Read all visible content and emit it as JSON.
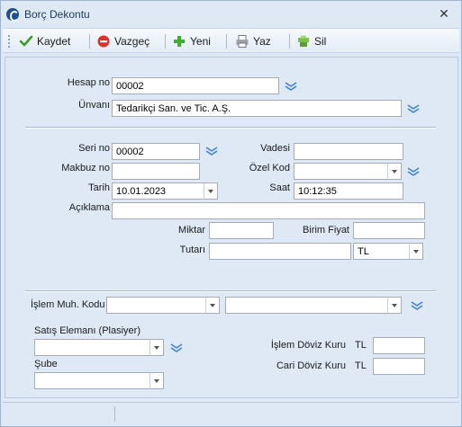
{
  "window": {
    "title": "Borç Dekontu"
  },
  "toolbar": {
    "kaydet": "Kaydet",
    "vazgec": "Vazgeç",
    "yeni": "Yeni",
    "yaz": "Yaz",
    "sil": "Sil"
  },
  "form": {
    "hesap_no_label": "Hesap no",
    "hesap_no": "00002",
    "unvan_label": "Ünvanı",
    "unvan": "Tedarikçi San. ve Tic. A.Ş.",
    "seri_no_label": "Seri no",
    "seri_no": "00002",
    "makbuz_no_label": "Makbuz no",
    "makbuz_no": "",
    "tarih_label": "Tarih",
    "tarih": "10.01.2023",
    "vadesi_label": "Vadesi",
    "vadesi": "",
    "ozel_kod_label": "Özel Kod",
    "ozel_kod": "",
    "saat_label": "Saat",
    "saat": "10:12:35",
    "aciklama_label": "Açıklama",
    "aciklama": "",
    "miktar_label": "Miktar",
    "miktar": "",
    "birim_fiyat_label": "Birim Fiyat",
    "birim_fiyat": "",
    "tutar_label": "Tutarı",
    "tutar": "",
    "currency": "TL",
    "islem_muh_kodu_label": "İşlem Muh. Kodu",
    "islem_muh_kodu_1": "",
    "islem_muh_kodu_2": "",
    "satis_elemani_label": "Satış Elemanı (Plasiyer)",
    "satis_elemani": "",
    "sube_label": "Şube",
    "sube": "",
    "islem_doviz_kuru_label": "İşlem Döviz Kuru",
    "islem_doviz_currency": "TL",
    "islem_doviz_kuru": "",
    "cari_doviz_kuru_label": "Cari Döviz Kuru",
    "cari_doviz_currency": "TL",
    "cari_doviz_kuru": ""
  },
  "colors": {
    "accent": "#1f4f8f",
    "lookup": "#3d7fd0",
    "window_bg": "#dfe9f5"
  },
  "icons": {
    "kaydet": "checkmark-icon",
    "vazgec": "cancel-icon",
    "yeni": "plus-icon",
    "yaz": "printer-icon",
    "sil": "delete-icon",
    "lookup": "chevron-down-lookup-icon"
  }
}
